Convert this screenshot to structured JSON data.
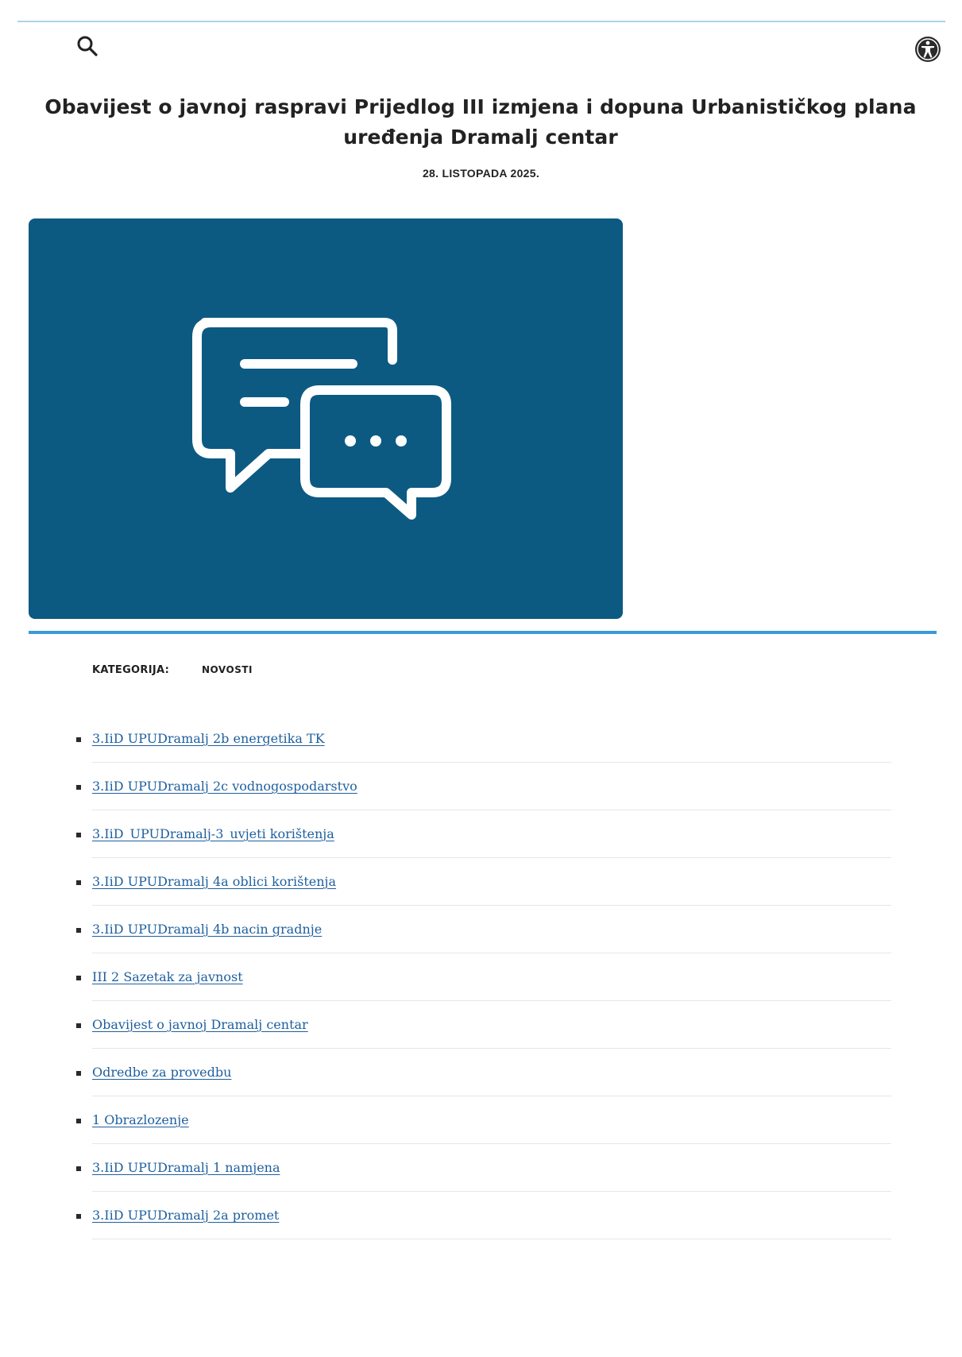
{
  "header": {
    "search_icon": "search-icon",
    "accessibility_icon": "accessibility-icon"
  },
  "article": {
    "title": "Obavijest o javnoj raspravi Prijedlog III izmjena i dopuna Urbanističkog plana uređenja Dramalj centar",
    "date": "28. LISTOPADA 2025.",
    "hero_icon": "chat-bubbles-icon",
    "category_label": "KATEGORIJA:",
    "category_value": "NOVOSTI"
  },
  "colors": {
    "hero_background": "#0c5a82",
    "accent_rule": "#3a9ad9",
    "link": "#1e5f9e"
  },
  "attachments": [
    {
      "label": "3.IiD UPUDramalj 2b energetika TK"
    },
    {
      "label": "3.IiD UPUDramalj 2c vodnogospodarstvo"
    },
    {
      "label": "3.IiD_UPUDramalj-3_uvjeti korištenja"
    },
    {
      "label": "3.IiD UPUDramalj 4a oblici korištenja"
    },
    {
      "label": "3.IiD UPUDramalj 4b nacin gradnje"
    },
    {
      "label": "III 2 Sazetak za javnost"
    },
    {
      "label": "Obavijest o javnoj Dramalj centar"
    },
    {
      "label": "Odredbe za provedbu"
    },
    {
      "label": "1 Obrazlozenje"
    },
    {
      "label": "3.IiD UPUDramalj 1 namjena"
    },
    {
      "label": "3.IiD UPUDramalj 2a promet"
    }
  ]
}
